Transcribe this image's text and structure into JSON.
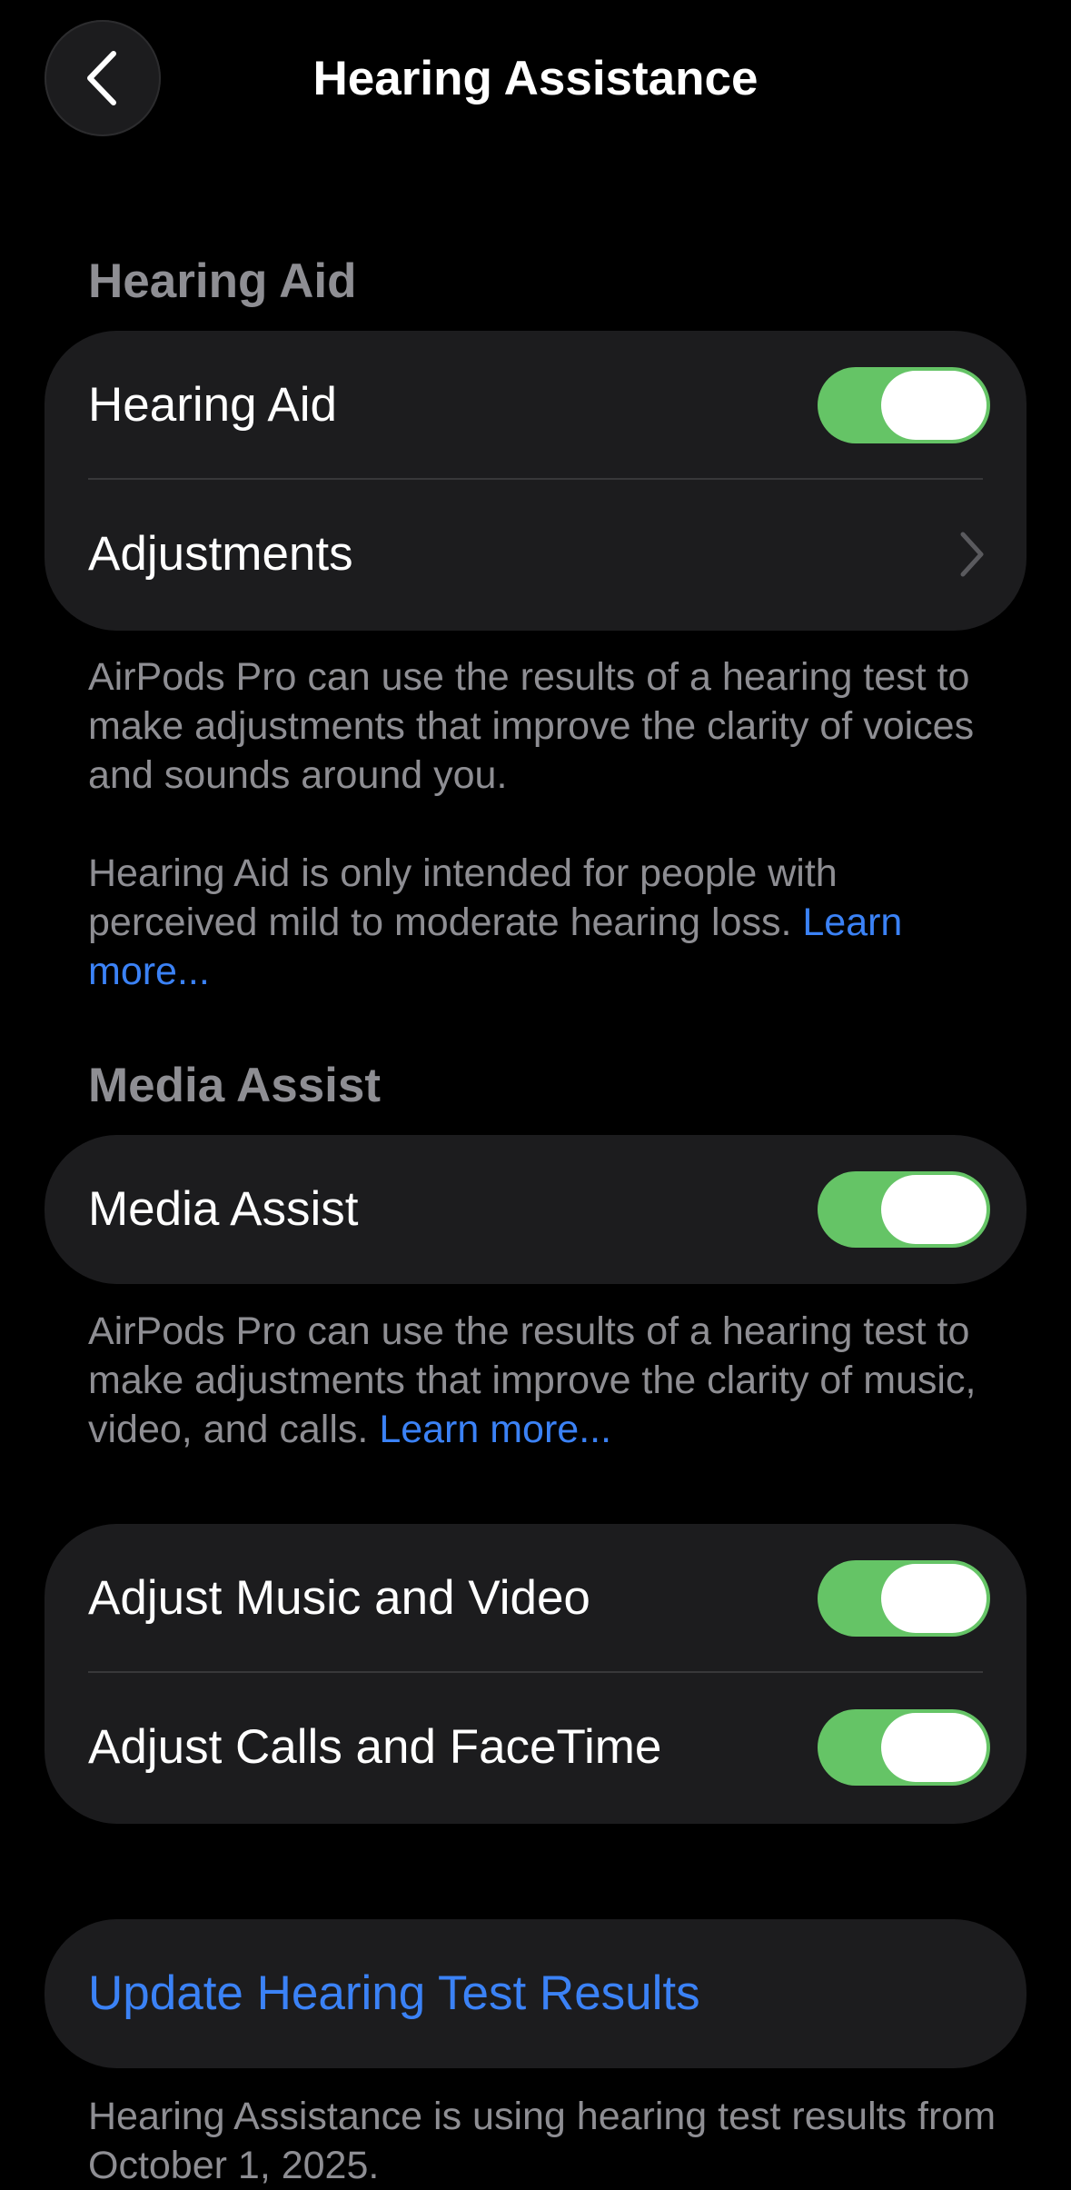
{
  "nav": {
    "title": "Hearing Assistance"
  },
  "hearing_aid_section": {
    "header": "Hearing Aid",
    "rows": [
      {
        "label": "Hearing Aid",
        "control": "toggle",
        "on": true
      },
      {
        "label": "Adjustments",
        "control": "chevron"
      }
    ],
    "footnote_1": "AirPods Pro can use the results of a hearing test to make adjustments that improve the clarity of voices and sounds around you.",
    "footnote_2": "Hearing Aid is only intended for people with perceived mild to moderate hearing loss.",
    "footnote_2_link": "Learn more..."
  },
  "media_assist_section": {
    "header": "Media Assist",
    "rows": [
      {
        "label": "Media Assist",
        "control": "toggle",
        "on": true
      }
    ],
    "footnote": "AirPods Pro can use the results of a hearing test to make adjustments that improve the clarity of music, video, and calls.",
    "footnote_link": "Learn more..."
  },
  "adjust_section": {
    "rows": [
      {
        "label": "Adjust Music and Video",
        "control": "toggle",
        "on": true
      },
      {
        "label": "Adjust Calls and FaceTime",
        "control": "toggle",
        "on": true
      }
    ]
  },
  "update_section": {
    "button_label": "Update Hearing Test Results",
    "footnote": "Hearing Assistance is using hearing test results from October 1, 2025."
  },
  "icons": {
    "back": "chevron-left-icon",
    "disclosure": "chevron-right-icon"
  },
  "colors": {
    "background": "#000000",
    "card": "#1c1c1e",
    "toggle_on": "#65c466",
    "secondary_text": "#8e8e93",
    "link": "#3b82f6"
  }
}
